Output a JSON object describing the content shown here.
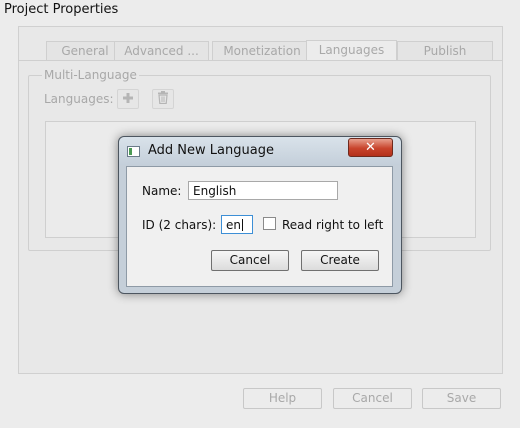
{
  "window": {
    "title": "Project Properties",
    "tabs": [
      {
        "label": "General"
      },
      {
        "label": "Advanced ..."
      },
      {
        "label": "Monetization"
      },
      {
        "label": "Languages"
      },
      {
        "label": "Publish"
      }
    ],
    "active_tab": "Languages",
    "group_title": "Multi-Language",
    "languages_label": "Languages:",
    "add_icon": "plus-icon",
    "delete_icon": "trash-icon",
    "footer": {
      "help_label": "Help",
      "cancel_label": "Cancel",
      "save_label": "Save"
    }
  },
  "dialog": {
    "title": "Add New Language",
    "close_glyph": "✕",
    "name_label": "Name:",
    "name_value": "English",
    "id_label": "ID (2 chars):",
    "id_value": "en",
    "rtl_label": "Read right to left",
    "rtl_checked": false,
    "cancel_label": "Cancel",
    "create_label": "Create"
  }
}
